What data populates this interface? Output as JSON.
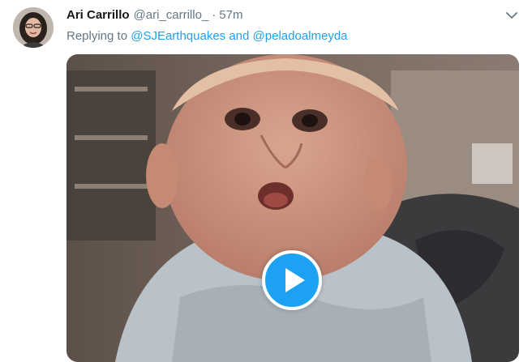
{
  "tweet": {
    "author_name": "Ari Carrillo",
    "author_handle": "@ari_carrillo_",
    "separator": "·",
    "time_ago": "57m",
    "reply_prefix": "Replying to",
    "reply_mention_1": "@SJEarthquakes",
    "reply_and": "and",
    "reply_mention_2": "@peladoalmeyda"
  },
  "colors": {
    "link": "#1da1f2",
    "secondary_text": "#657786",
    "play_button": "#1da1f2"
  },
  "icons": {
    "menu": "chevron-down-icon",
    "media": "play-icon"
  }
}
